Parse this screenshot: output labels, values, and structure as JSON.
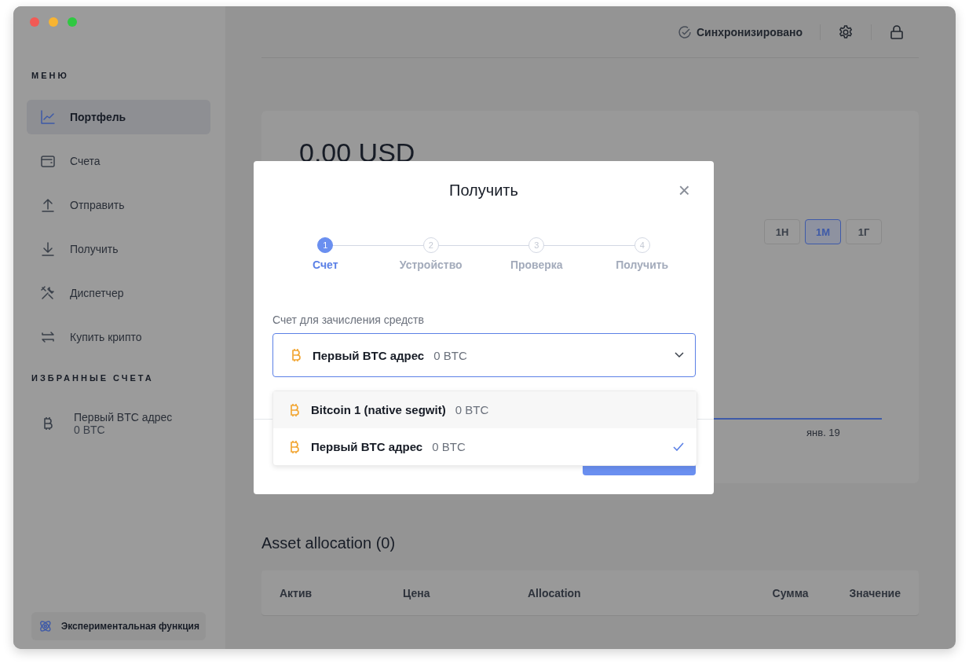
{
  "sidebar": {
    "menu_title": "МЕНЮ",
    "items": [
      {
        "label": "Портфель",
        "selected": true
      },
      {
        "label": "Счета",
        "selected": false
      },
      {
        "label": "Отправить",
        "selected": false
      },
      {
        "label": "Получить",
        "selected": false
      },
      {
        "label": "Диспетчер",
        "selected": false
      },
      {
        "label": "Купить крипто",
        "selected": false
      }
    ],
    "favorites_title": "ИЗБРАННЫЕ СЧЕТА",
    "favorites": [
      {
        "name": "Первый BTC адрес",
        "balance": "0 BTC"
      }
    ],
    "experimental_button": "Экспериментальная функция"
  },
  "header": {
    "sync_status": "Синхронизировано"
  },
  "portfolio": {
    "balance": "0,00 USD",
    "ranges": [
      {
        "label": "1Н",
        "selected": false
      },
      {
        "label": "1М",
        "selected": true
      },
      {
        "label": "1Г",
        "selected": false
      }
    ],
    "chart_axis_label": "янв. 19"
  },
  "asset_allocation": {
    "title": "Asset allocation (0)",
    "columns": [
      "Актив",
      "Цена",
      "Allocation",
      "Сумма",
      "Значение"
    ]
  },
  "modal": {
    "title": "Получить",
    "close": "×",
    "steps": [
      {
        "number": "1",
        "label": "Счет",
        "selected": true
      },
      {
        "number": "2",
        "label": "Устройство",
        "selected": false
      },
      {
        "number": "3",
        "label": "Проверка",
        "selected": false
      },
      {
        "number": "4",
        "label": "Получить",
        "selected": false
      }
    ],
    "field_label": "Счет для зачисления средств",
    "select": {
      "name": "Первый BTC адрес",
      "balance": "0 BTC"
    },
    "options": [
      {
        "name": "Bitcoin 1 (native segwit)",
        "balance": "0 BTC",
        "selected": false,
        "hovered": true
      },
      {
        "name": "Первый BTC адрес",
        "balance": "0 BTC",
        "selected": true,
        "hovered": false
      }
    ]
  }
}
